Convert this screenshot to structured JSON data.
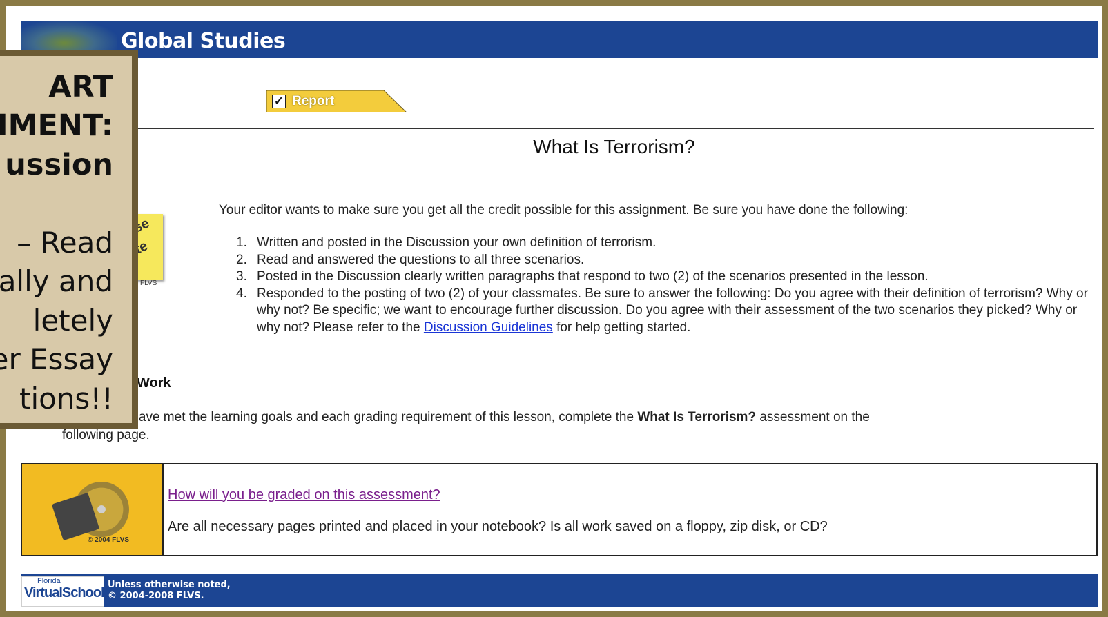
{
  "header": {
    "title": "Global Studies"
  },
  "tab": {
    "label": "Report"
  },
  "lesson": {
    "title": "What Is Terrorism?"
  },
  "note_image": {
    "line1": "se",
    "line2": "te",
    "copyright": "FLVS"
  },
  "intro": "Your editor wants to make sure you get all the credit possible for this assignment. Be sure you have done the following:",
  "requirements": [
    {
      "num": "1.",
      "text": "Written and posted in the Discussion your own definition of terrorism."
    },
    {
      "num": "2.",
      "text": "Read and answered the questions to all three scenarios."
    },
    {
      "num": "3.",
      "text": "Posted in the Discussion clearly written paragraphs that respond to two (2) of the scenarios presented in the lesson."
    },
    {
      "num": "4.",
      "text": "Responded to the posting of two (2) of your classmates. Be sure to answer the following: Do you agree with their definition of terrorism? Why or why not? Be specific; we want to encourage further discussion. Do you agree with their assessment of the two scenarios they picked? Why or why not? Please refer to the ",
      "link": "Discussion Guidelines",
      "after": " for help getting started."
    }
  ],
  "work": {
    "heading": "Work",
    "text_before": "re sure you have met the learning goals and each grading requirement of this lesson, complete the ",
    "bold": "What Is Terrorism?",
    "text_after": " assessment on the",
    "line2": "following page."
  },
  "grade": {
    "link": "How will you be graded on this assessment?",
    "question": "Are all necessary pages printed and placed in your notebook? Is all work saved on a floppy, zip disk, or CD?",
    "image_copyright": "© 2004 FLVS"
  },
  "footer": {
    "logo_small": "Florida",
    "logo_main": "VirtualSchool",
    "note_line1": "Unless otherwise noted,",
    "note_line2": "© 2004-2008 FLVS."
  },
  "overlay": {
    "lines": [
      "ART",
      "IMENT:",
      "ussion",
      "– Read",
      "ally and",
      "letely",
      "er Essay",
      "tions!!"
    ]
  },
  "colors": {
    "header_blue": "#1c4593",
    "frame": "#8a7a45",
    "overlay_bg": "#d8c9a9",
    "tab_yellow": "#f3cc3c",
    "box_yellow": "#f2bb22"
  }
}
